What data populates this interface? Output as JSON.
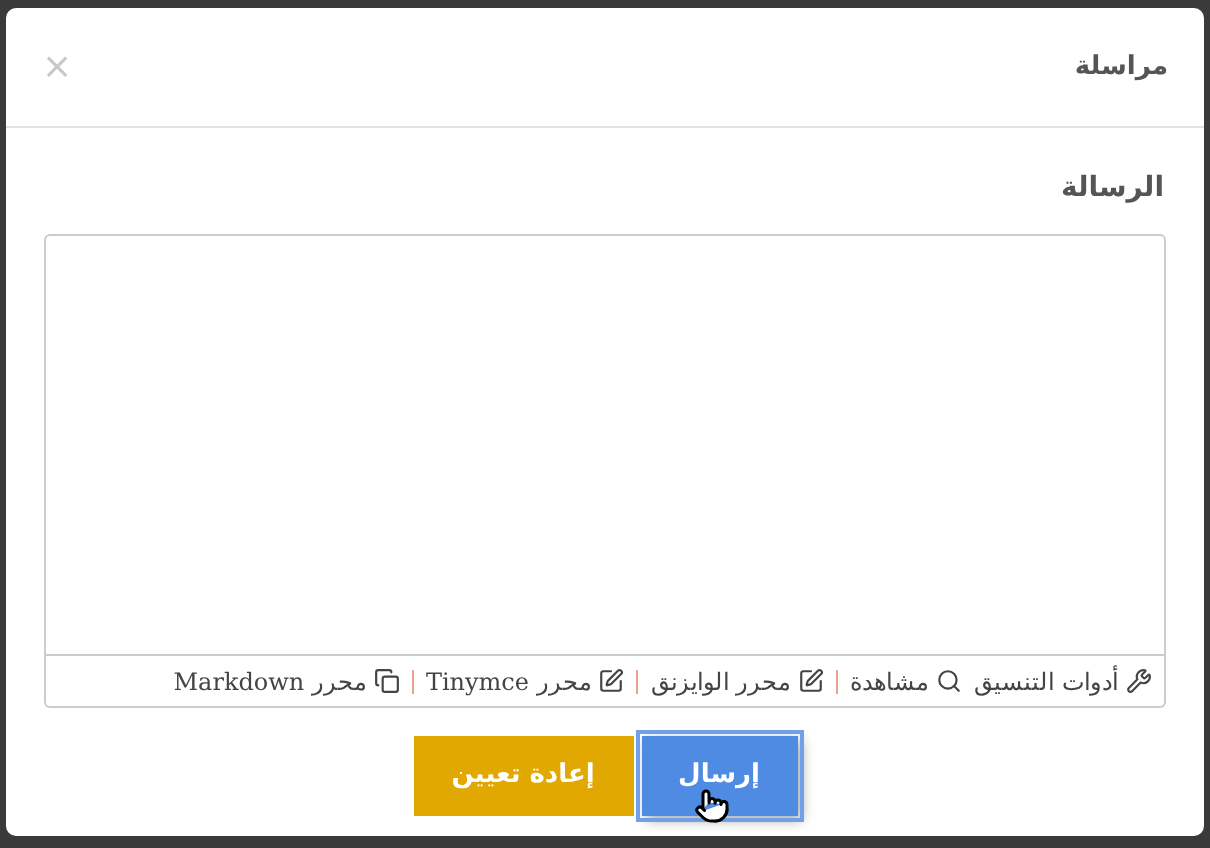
{
  "dialog": {
    "title": "مراسلة",
    "close": "×"
  },
  "message": {
    "label": "الرسالة"
  },
  "editor_tabs": [
    {
      "label": "أدوات التنسيق",
      "kind": "tools"
    },
    {
      "label": "مشاهدة",
      "kind": "search"
    },
    {
      "label": "محرر الوايزنق",
      "kind": "edit"
    },
    {
      "label": "محرر Tinymce",
      "kind": "edit"
    },
    {
      "label": "محرر Markdown",
      "kind": "windows"
    }
  ],
  "buttons": [
    {
      "label": "إرسال",
      "kind": "primary",
      "focused": true
    },
    {
      "label": "إعادة تعيين",
      "kind": "warning",
      "focused": false
    }
  ]
}
